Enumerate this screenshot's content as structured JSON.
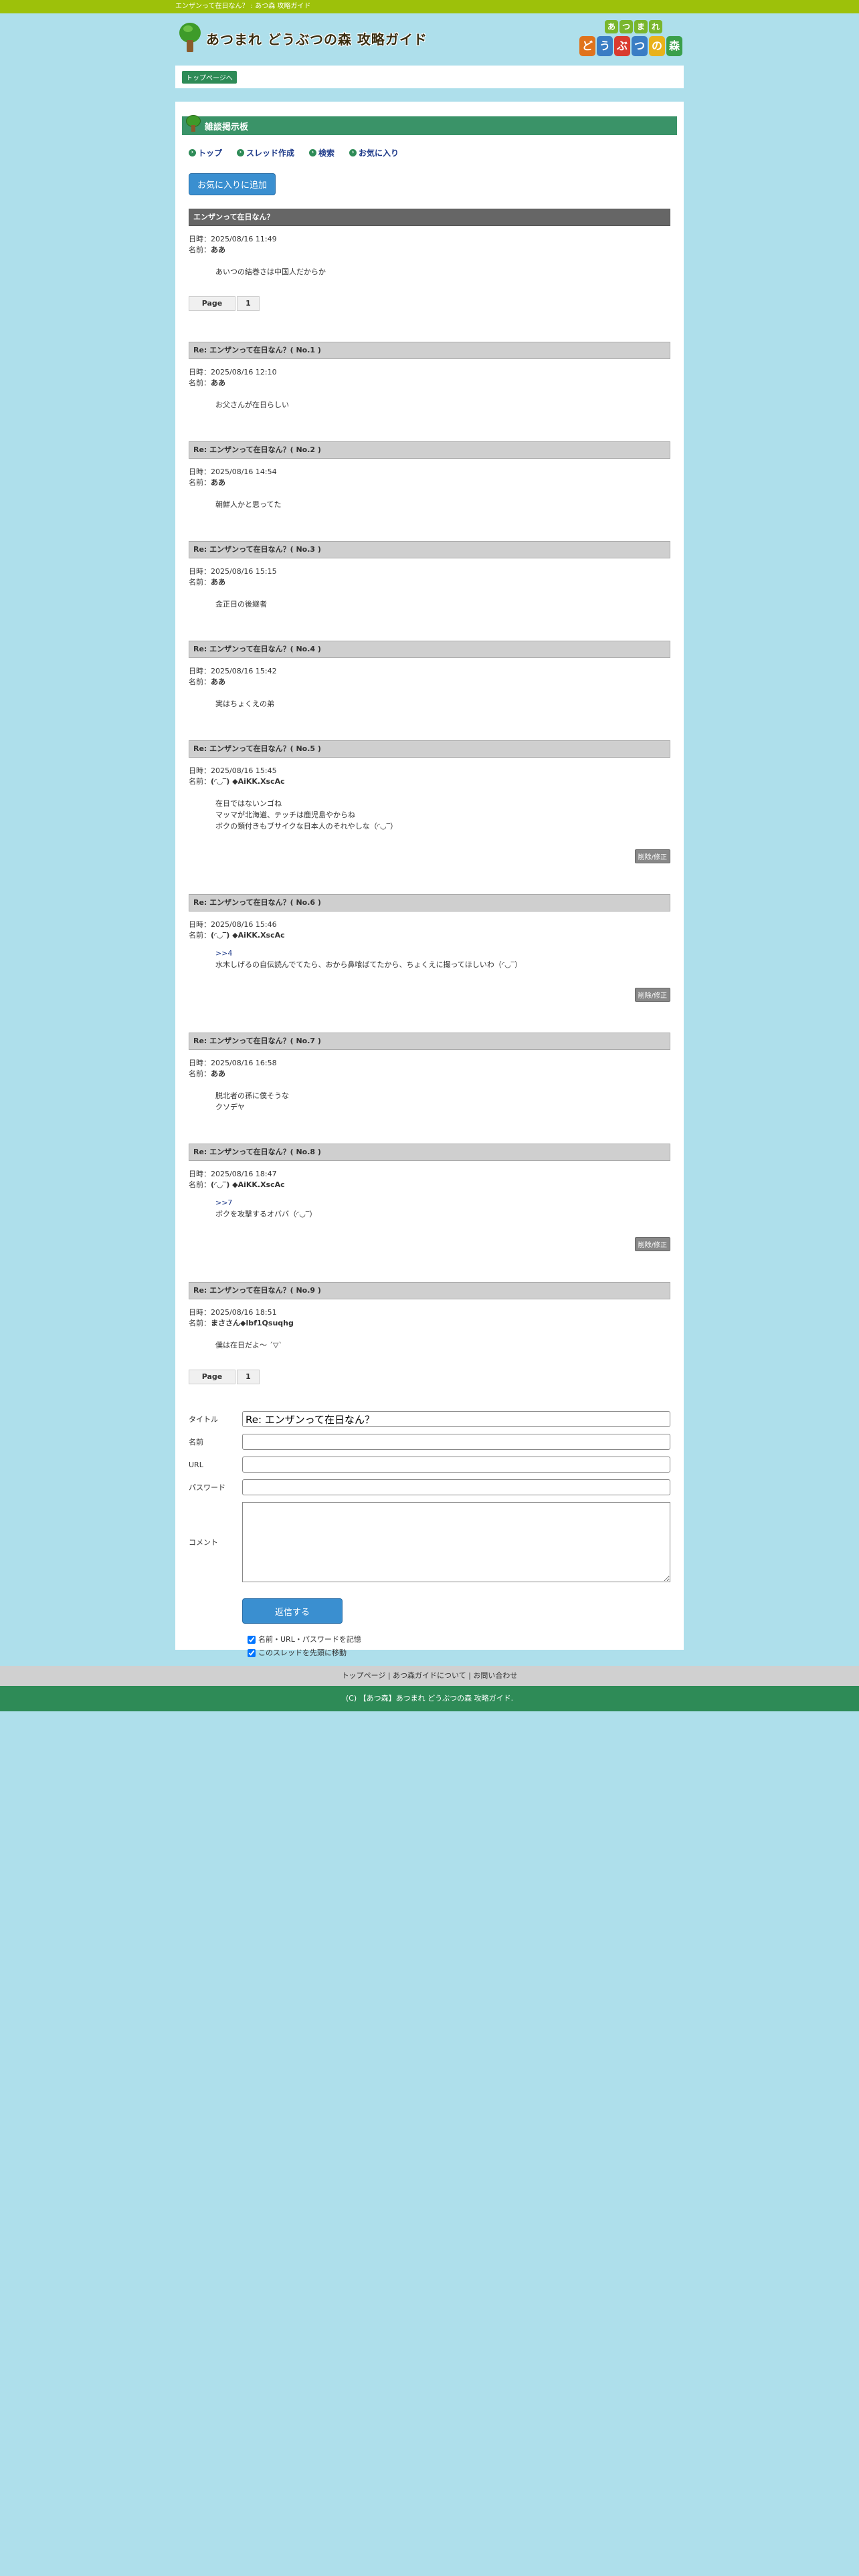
{
  "topbar": {
    "text": "エンザンって在日なん？ : あつ森 攻略ガイド"
  },
  "header": {
    "site_title": "あつまれ どうぶつの森 攻略ガイド"
  },
  "brand_logo": {
    "top": [
      "あ",
      "つ",
      "ま",
      "れ"
    ],
    "bottom": [
      "ど",
      "う",
      "ぶ",
      "つ",
      "の",
      "森"
    ],
    "bottom_colors": [
      "#e0731c",
      "#3a7dc4",
      "#d93b2f",
      "#3a7dc4",
      "#e9b21a",
      "#3a9f4a"
    ]
  },
  "breadcrumb": {
    "top_link": "トップページへ"
  },
  "board": {
    "title": "雑談掲示板"
  },
  "nav": {
    "top": "トップ",
    "create": "スレッド作成",
    "search": "検索",
    "favorites": "お気に入り"
  },
  "fav_button": "お気に入りに追加",
  "meta_labels": {
    "date": "日時：",
    "name": "名前："
  },
  "edit_label": "削除/修正",
  "pager": {
    "label": "Page",
    "page": "1"
  },
  "posts": [
    {
      "title": "エンザンって在日なん？",
      "date": "2025/08/16 11:49",
      "name": "ああ",
      "lines": [
        "あいつの結巻さは中国人だからか"
      ]
    },
    {
      "title": "Re: エンザンって在日なん？( No.1 )",
      "date": "2025/08/16 12:10",
      "name": "ああ",
      "lines": [
        "お父さんが在日らしい"
      ]
    },
    {
      "title": "Re: エンザンって在日なん？( No.2 )",
      "date": "2025/08/16 14:54",
      "name": "ああ",
      "lines": [
        "朝鮮人かと思ってた"
      ]
    },
    {
      "title": "Re: エンザンって在日なん？( No.3 )",
      "date": "2025/08/16 15:15",
      "name": "ああ",
      "lines": [
        "金正日の後継者"
      ]
    },
    {
      "title": "Re: エンザンって在日なん？( No.4 )",
      "date": "2025/08/16 15:42",
      "name": "ああ",
      "lines": [
        "実はちょくえの弟"
      ]
    },
    {
      "title": "Re: エンザンって在日なん？( No.5 )",
      "date": "2025/08/16 15:45",
      "name": "(◜◡‾) ◆AiKK.XscAc",
      "lines": [
        "在日ではないンゴね",
        "マッマが北海道、テッチは鹿児島やからね",
        "ボクの類付きもブサイクな日本人のそれやしな（◜◡‾）"
      ]
    },
    {
      "title": "Re: エンザンって在日なん？( No.6 )",
      "date": "2025/08/16 15:46",
      "name": "(◜◡‾) ◆AiKK.XscAc",
      "anchor": ">>4",
      "lines": [
        "水木しげるの自伝読んでてたら、おから鼻喰ばてたから、ちょくえに撮ってほしいわ（◜◡‾）"
      ]
    },
    {
      "title": "Re: エンザンって在日なん？( No.7 )",
      "date": "2025/08/16 16:58",
      "name": "ああ",
      "lines": [
        "脱北者の孫に僕そうな",
        "クソデヤ"
      ]
    },
    {
      "title": "Re: エンザンって在日なん？( No.8 )",
      "date": "2025/08/16 18:47",
      "name": "(◜◡‾) ◆AiKK.XscAc",
      "anchor": ">>7",
      "lines": [
        "ボクを攻撃するオババ（◜◡‾）"
      ]
    },
    {
      "title": "Re: エンザンって在日なん？( No.9 )",
      "date": "2025/08/16 18:51",
      "name": "まささん◆lbf1Qsuqhg",
      "lines": [
        "僕は在日だよ〜 ´▽`"
      ]
    }
  ],
  "form": {
    "title_label": "タイトル",
    "title_value": "Re: エンザンって在日なん？",
    "name_label": "名前",
    "url_label": "URL",
    "password_label": "パスワード",
    "comment_label": "コメント",
    "submit": "返信する",
    "check1": "名前・URL・パスワードを記憶",
    "check2": "このスレッドを先頭に移動"
  },
  "footer": {
    "links": "トップページ | あつ森ガイドについて | お問い合わせ",
    "copyright": "(C) 【あつ森】あつまれ どうぶつの森 攻略ガイド."
  }
}
